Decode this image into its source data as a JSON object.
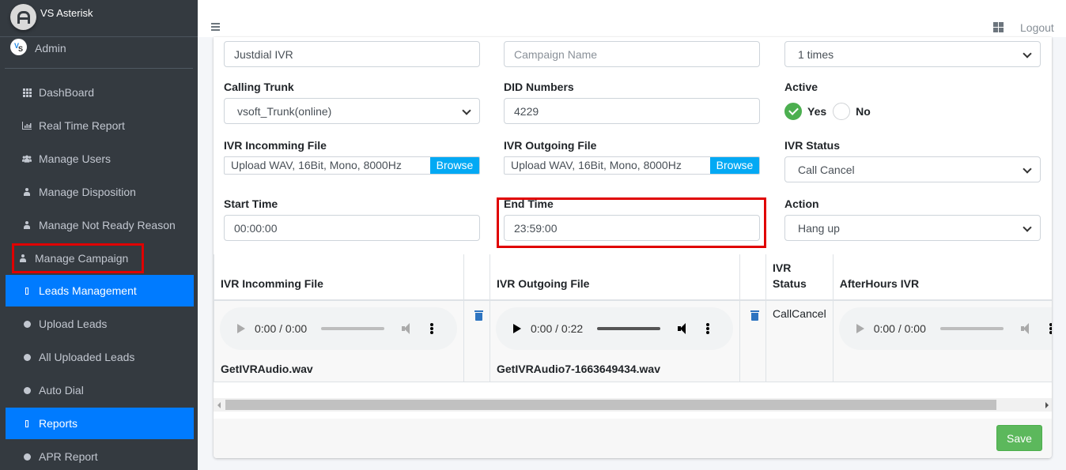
{
  "brand": {
    "title": "VS Asterisk",
    "logo_icon": "asterisk-logo-icon"
  },
  "user": {
    "name": "Admin",
    "avatar_text": "VS"
  },
  "sidebar": {
    "items": [
      {
        "label": "DashBoard",
        "icon": "grid-icon",
        "state": "normal"
      },
      {
        "label": "Real Time Report",
        "icon": "bar-chart-icon",
        "state": "normal"
      },
      {
        "label": "Manage Users",
        "icon": "users-icon",
        "state": "normal"
      },
      {
        "label": "Manage Disposition",
        "icon": "user-icon",
        "state": "normal"
      },
      {
        "label": "Manage Not Ready Reason",
        "icon": "user-icon",
        "state": "normal"
      },
      {
        "label": "Manage Campaign",
        "icon": "user-icon",
        "state": "highlighted"
      },
      {
        "label": "Leads Management",
        "icon": "square-icon",
        "state": "active"
      },
      {
        "label": "Upload Leads",
        "icon": "circle-icon",
        "state": "normal"
      },
      {
        "label": "All Uploaded Leads",
        "icon": "circle-icon",
        "state": "normal"
      },
      {
        "label": "Auto Dial",
        "icon": "circle-icon",
        "state": "normal"
      },
      {
        "label": "Reports",
        "icon": "square-icon",
        "state": "active"
      },
      {
        "label": "APR Report",
        "icon": "circle-icon",
        "state": "normal"
      }
    ]
  },
  "topbar": {
    "menu_icon": "hamburger-icon",
    "apps_icon": "apps-grid-icon",
    "logout_label": "Logout"
  },
  "form": {
    "ivr_name": {
      "value": "Justdial IVR"
    },
    "campaign_name": {
      "placeholder": "Campaign Name",
      "value": ""
    },
    "repeat": {
      "value": "1 times"
    },
    "calling_trunk": {
      "label": "Calling Trunk",
      "value": "vsoft_Trunk(online)"
    },
    "did_numbers": {
      "label": "DID Numbers",
      "value": "4229"
    },
    "active": {
      "label": "Active",
      "options": [
        "Yes",
        "No"
      ],
      "selected": "Yes"
    },
    "ivr_incoming_file": {
      "label": "IVR Incomming File",
      "placeholder": "Upload WAV, 16Bit, Mono, 8000Hz",
      "browse_label": "Browse"
    },
    "ivr_outgoing_file": {
      "label": "IVR Outgoing File",
      "placeholder": "Upload WAV, 16Bit, Mono, 8000Hz",
      "browse_label": "Browse"
    },
    "ivr_status": {
      "label": "IVR Status",
      "value": "Call Cancel"
    },
    "start_time": {
      "label": "Start Time",
      "value": "00:00:00"
    },
    "end_time": {
      "label": "End Time",
      "value": "23:59:00"
    },
    "action": {
      "label": "Action",
      "value": "Hang up"
    }
  },
  "table": {
    "headers": [
      "IVR Incomming File",
      "",
      "IVR Outgoing File",
      "",
      "IVR Status",
      "AfterHours IVR"
    ],
    "row": {
      "incoming_audio": {
        "time": "0:00 / 0:00",
        "filename": "GetIVRAudio.wav",
        "enabled": false
      },
      "outgoing_audio": {
        "time": "0:00 / 0:22",
        "filename": "GetIVRAudio7-1663649434.wav",
        "enabled": true
      },
      "ivr_status": "CallCancel",
      "afterhours_audio": {
        "time": "0:00 / 0:00",
        "enabled": false
      }
    }
  },
  "footer": {
    "save_label": "Save"
  },
  "colors": {
    "sidebar_bg": "#343a40",
    "active_nav": "#007bff",
    "highlight_box": "#e00000",
    "browse_btn": "#03a9f4",
    "save_btn": "#5cb85c",
    "radio_checked": "#4caf50"
  }
}
